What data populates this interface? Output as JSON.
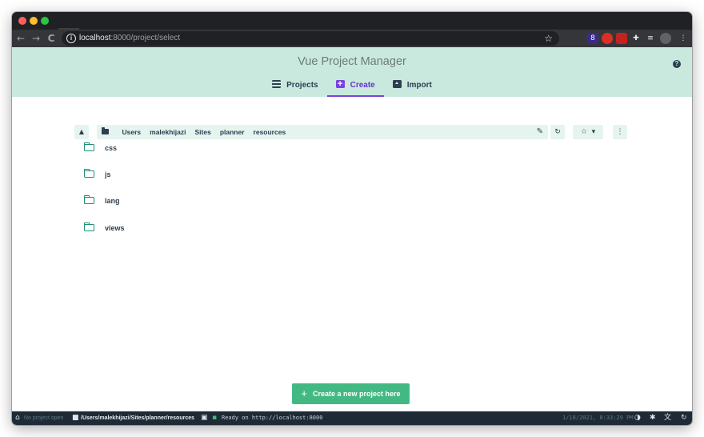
{
  "browser": {
    "url_host": "localhost",
    "url_path": ":8000/project/select",
    "nav": {
      "back": "←",
      "forward": "→",
      "reload": "C"
    },
    "icons": [
      "info-icon",
      "star-icon",
      "extension-icons"
    ],
    "ext_badge": "8"
  },
  "app": {
    "title": "Vue Project Manager",
    "tabs": [
      {
        "label": "Projects",
        "icon": "list-icon",
        "active": false
      },
      {
        "label": "Create",
        "icon": "plus-square-icon",
        "active": true
      },
      {
        "label": "Import",
        "icon": "import-icon",
        "active": false
      }
    ],
    "accent_color": "#42b983",
    "active_tab_color": "#7b41e0"
  },
  "pathbar": {
    "crumbs": [
      "Users",
      "malekhijazi",
      "Sites",
      "planner",
      "resources"
    ]
  },
  "folders": [
    "css",
    "js",
    "lang",
    "views"
  ],
  "create_button": {
    "label": "Create a new project here"
  },
  "statusbar": {
    "project": "No project open",
    "path": "/Users/malekhijazi/Sites/planner/resources",
    "log": "Ready on http://localhost:8000",
    "datetime": "1/18/2021, 8:33:29 PM"
  }
}
